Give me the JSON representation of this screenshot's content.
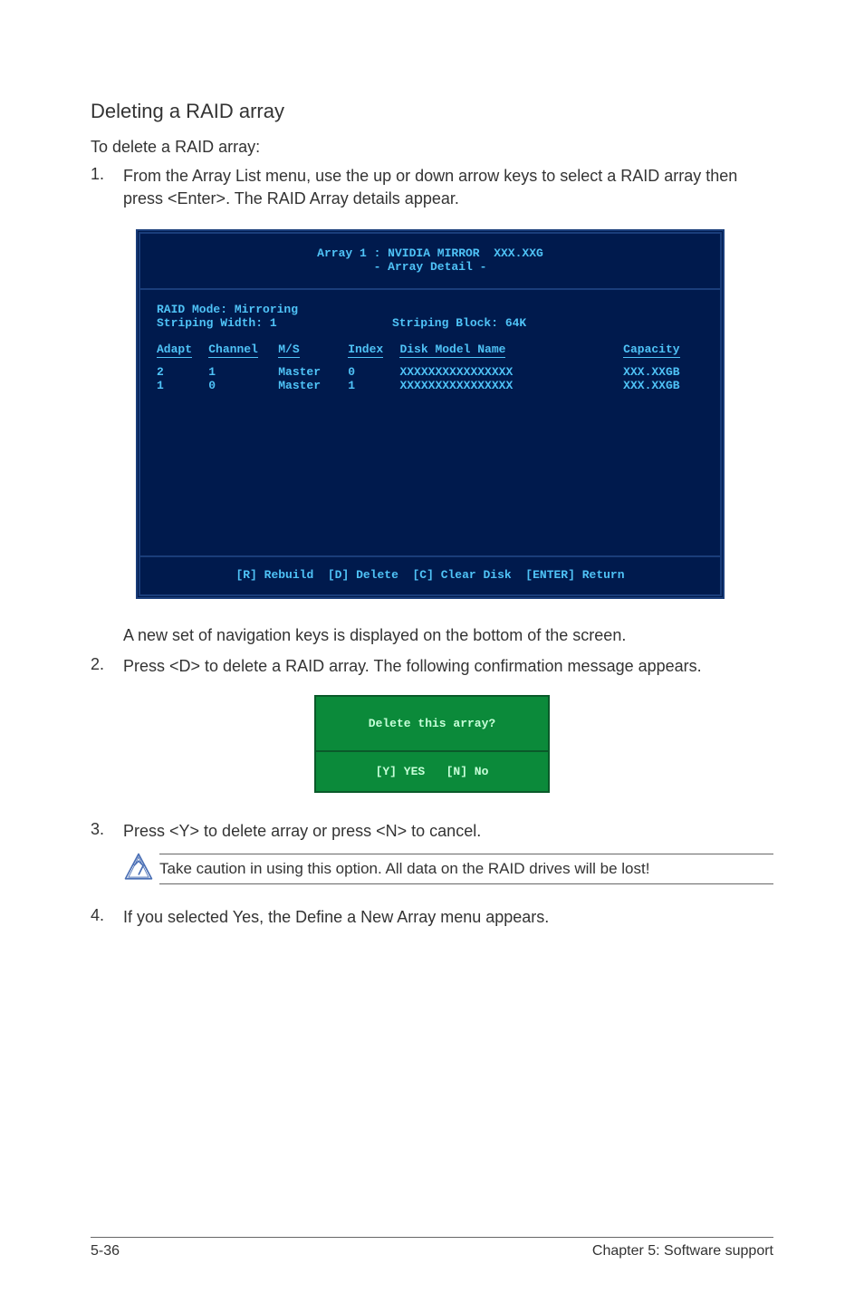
{
  "heading": "Deleting a RAID array",
  "intro": "To delete a RAID array:",
  "steps": {
    "s1": {
      "num": "1.",
      "text": "From the Array List menu, use the up or down arrow keys to select a RAID array then press <Enter>. The RAID Array details appear."
    },
    "s1b": {
      "text": "A new set of  navigation keys is displayed on the bottom of the screen."
    },
    "s2": {
      "num": "2.",
      "text": "Press <D> to delete a RAID array. The following confirmation message appears."
    },
    "s3": {
      "num": "3.",
      "text": "Press <Y> to delete array or press <N> to cancel."
    },
    "s4": {
      "num": "4.",
      "text": "If you selected Yes, the Define a New Array menu appears."
    }
  },
  "bios": {
    "title": "Array 1 : NVIDIA MIRROR  XXX.XXG",
    "subtitle": "- Array Detail -",
    "raid_mode": "RAID Mode: Mirroring",
    "striping_width": "Striping Width: 1",
    "striping_block": "Striping Block: 64K",
    "headers": {
      "adapt": "Adapt",
      "channel": "Channel",
      "ms": "M/S",
      "index": "Index",
      "model": "Disk Model Name",
      "capacity": "Capacity"
    },
    "rows": [
      {
        "adapt": "2",
        "channel": "1",
        "ms": "Master",
        "index": "0",
        "model": "XXXXXXXXXXXXXXXX",
        "capacity": "XXX.XXGB"
      },
      {
        "adapt": "1",
        "channel": "0",
        "ms": "Master",
        "index": "1",
        "model": "XXXXXXXXXXXXXXXX",
        "capacity": "XXX.XXGB"
      }
    ],
    "footer": "[R] Rebuild  [D] Delete  [C] Clear Disk  [ENTER] Return"
  },
  "dialog": {
    "question": "Delete this array?",
    "options": "[Y] YES   [N] No"
  },
  "note": "Take caution in using this option. All data on the RAID drives will be lost!",
  "footer": {
    "left": "5-36",
    "right": "Chapter 5: Software support"
  }
}
